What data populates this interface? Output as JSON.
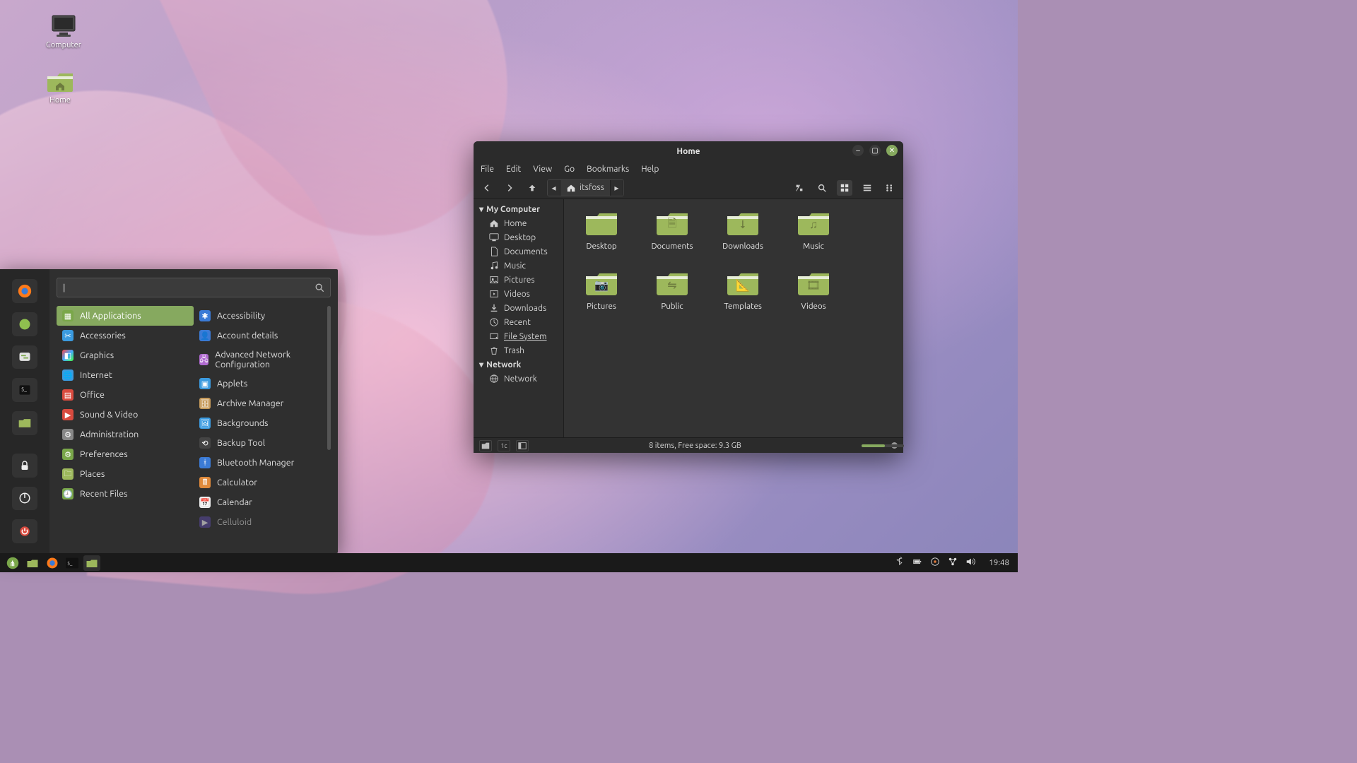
{
  "desktop": {
    "computer_label": "Computer",
    "home_label": "Home"
  },
  "fm": {
    "title": "Home",
    "menu": [
      "File",
      "Edit",
      "View",
      "Go",
      "Bookmarks",
      "Help"
    ],
    "path_user": "itsfoss",
    "sidebar_header1": "My Computer",
    "sidebar_header2": "Network",
    "places": {
      "home": "Home",
      "desktop": "Desktop",
      "documents": "Documents",
      "music": "Music",
      "pictures": "Pictures",
      "videos": "Videos",
      "downloads": "Downloads",
      "recent": "Recent",
      "filesystem": "File System",
      "trash": "Trash",
      "network": "Network"
    },
    "folders": {
      "desktop": "Desktop",
      "documents": "Documents",
      "downloads": "Downloads",
      "music": "Music",
      "pictures": "Pictures",
      "public": "Public",
      "templates": "Templates",
      "videos": "Videos"
    },
    "status": "8 items, Free space: 9.3 GB"
  },
  "startmenu": {
    "search_placeholder": "",
    "categories": {
      "all": "All Applications",
      "accessories": "Accessories",
      "graphics": "Graphics",
      "internet": "Internet",
      "office": "Office",
      "sound": "Sound & Video",
      "admin": "Administration",
      "prefs": "Preferences",
      "places": "Places",
      "recent": "Recent Files"
    },
    "apps": {
      "accessibility": "Accessibility",
      "account": "Account details",
      "network": "Advanced Network Configuration",
      "applets": "Applets",
      "archive": "Archive Manager",
      "backgrounds": "Backgrounds",
      "backup": "Backup Tool",
      "bluetooth": "Bluetooth Manager",
      "calculator": "Calculator",
      "calendar": "Calendar",
      "celluloid": "Celluloid"
    }
  },
  "panel": {
    "time": "19:48"
  }
}
